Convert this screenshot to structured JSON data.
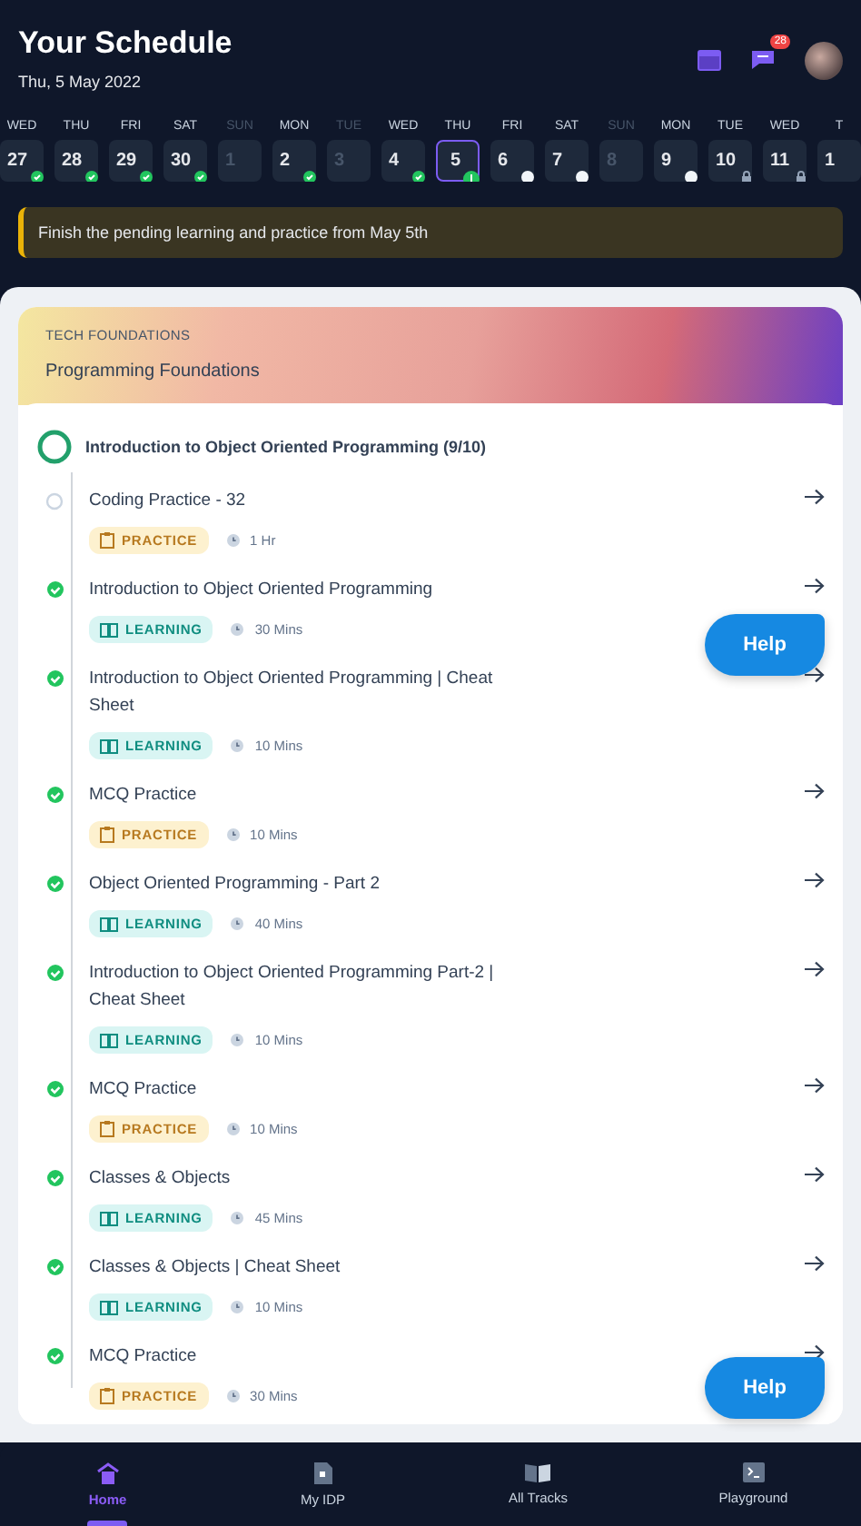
{
  "header": {
    "title": "Your Schedule",
    "date": "Thu, 5 May 2022",
    "notifications": "28"
  },
  "days": [
    {
      "label": "WED",
      "number": "27",
      "muted": false,
      "selected": false,
      "kind": "done"
    },
    {
      "label": "THU",
      "number": "28",
      "muted": false,
      "selected": false,
      "kind": "done"
    },
    {
      "label": "FRI",
      "number": "29",
      "muted": false,
      "selected": false,
      "kind": "done"
    },
    {
      "label": "SAT",
      "number": "30",
      "muted": false,
      "selected": false,
      "kind": "done"
    },
    {
      "label": "SUN",
      "number": "1",
      "muted": true,
      "selected": false,
      "kind": "none"
    },
    {
      "label": "MON",
      "number": "2",
      "muted": false,
      "selected": false,
      "kind": "done"
    },
    {
      "label": "TUE",
      "number": "3",
      "muted": true,
      "selected": false,
      "kind": "none"
    },
    {
      "label": "WED",
      "number": "4",
      "muted": false,
      "selected": false,
      "kind": "done"
    },
    {
      "label": "THU",
      "number": "5",
      "muted": false,
      "selected": true,
      "kind": "alert"
    },
    {
      "label": "FRI",
      "number": "6",
      "muted": false,
      "selected": false,
      "kind": "pending"
    },
    {
      "label": "SAT",
      "number": "7",
      "muted": false,
      "selected": false,
      "kind": "pending"
    },
    {
      "label": "SUN",
      "number": "8",
      "muted": true,
      "selected": false,
      "kind": "none"
    },
    {
      "label": "MON",
      "number": "9",
      "muted": false,
      "selected": false,
      "kind": "pending"
    },
    {
      "label": "TUE",
      "number": "10",
      "muted": false,
      "selected": false,
      "kind": "locked"
    },
    {
      "label": "WED",
      "number": "11",
      "muted": false,
      "selected": false,
      "kind": "locked"
    },
    {
      "label": "T",
      "number": "1",
      "muted": false,
      "selected": false,
      "kind": "none"
    }
  ],
  "notice": "Finish the pending learning and practice from May 5th",
  "track": {
    "category": "TECH FOUNDATIONS",
    "name": "Programming Foundations"
  },
  "module": {
    "title": "Introduction to Object Oriented Programming (9/10)"
  },
  "items": [
    {
      "title": "Coding Practice - 32",
      "kind": "practice",
      "tag": "PRACTICE",
      "duration": "1 Hr",
      "completed": false
    },
    {
      "title": "Introduction to Object Oriented Programming",
      "kind": "learning",
      "tag": "LEARNING",
      "duration": "30 Mins",
      "completed": true
    },
    {
      "title": "Introduction to Object Oriented Programming | Cheat Sheet",
      "kind": "learning",
      "tag": "LEARNING",
      "duration": "10 Mins",
      "completed": true
    },
    {
      "title": "MCQ Practice",
      "kind": "practice",
      "tag": "PRACTICE",
      "duration": "10 Mins",
      "completed": true
    },
    {
      "title": "Object Oriented Programming - Part 2",
      "kind": "learning",
      "tag": "LEARNING",
      "duration": "40 Mins",
      "completed": true
    },
    {
      "title": "Introduction to Object Oriented Programming Part-2 | Cheat Sheet",
      "kind": "learning",
      "tag": "LEARNING",
      "duration": "10 Mins",
      "completed": true
    },
    {
      "title": "MCQ Practice",
      "kind": "practice",
      "tag": "PRACTICE",
      "duration": "10 Mins",
      "completed": true
    },
    {
      "title": "Classes & Objects",
      "kind": "learning",
      "tag": "LEARNING",
      "duration": "45 Mins",
      "completed": true
    },
    {
      "title": "Classes & Objects | Cheat Sheet",
      "kind": "learning",
      "tag": "LEARNING",
      "duration": "10 Mins",
      "completed": true
    },
    {
      "title": "MCQ Practice",
      "kind": "practice",
      "tag": "PRACTICE",
      "duration": "30 Mins",
      "completed": true
    }
  ],
  "help_buttons": [
    "Help",
    "Help"
  ],
  "nav": [
    {
      "label": "Home",
      "selected": true
    },
    {
      "label": "My IDP",
      "selected": false
    },
    {
      "label": "All Tracks",
      "selected": false
    },
    {
      "label": "Playground",
      "selected": false
    }
  ]
}
